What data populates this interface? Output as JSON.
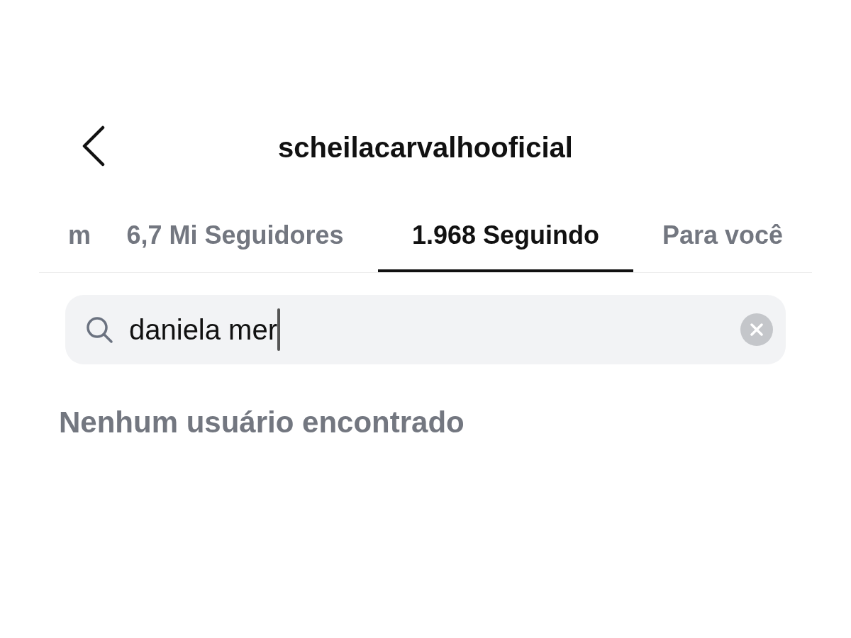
{
  "header": {
    "title": "scheilacarvalhooficial"
  },
  "tabs": [
    {
      "label": "m",
      "selected": false
    },
    {
      "label": "6,7 Mi Seguidores",
      "selected": false
    },
    {
      "label": "1.968 Seguindo",
      "selected": true
    },
    {
      "label": "Para você",
      "selected": false
    }
  ],
  "search": {
    "value": "daniela mer"
  },
  "message": "Nenhum usuário encontrado"
}
